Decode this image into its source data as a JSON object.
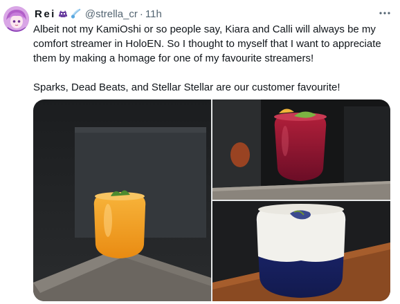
{
  "tweet": {
    "author": {
      "display_name": "Rei",
      "handle": "@strella_cr",
      "separator": "·",
      "time": "11h",
      "name_emojis": [
        "alien-emoji",
        "comet-emoji"
      ]
    },
    "text_lines": [
      "Albeit not my KamiOshi or so people say, Kiara and Calli will always be my comfort streamer in HoloEN. So I thought to myself that I want to appreciate them by making a homage for one of my favourite streamers!",
      "Sparks, Dead Beats, and Stellar Stellar are our customer favourite!"
    ],
    "more_icon": "ellipsis-icon",
    "media": [
      {
        "subject": "orange-cocktail-photo"
      },
      {
        "subject": "red-cocktail-photo"
      },
      {
        "subject": "blue-white-cocktail-photo"
      }
    ]
  },
  "colors": {
    "text": "#0f1419",
    "muted": "#536471",
    "background": "#ffffff",
    "border": "#e7e9ea"
  }
}
